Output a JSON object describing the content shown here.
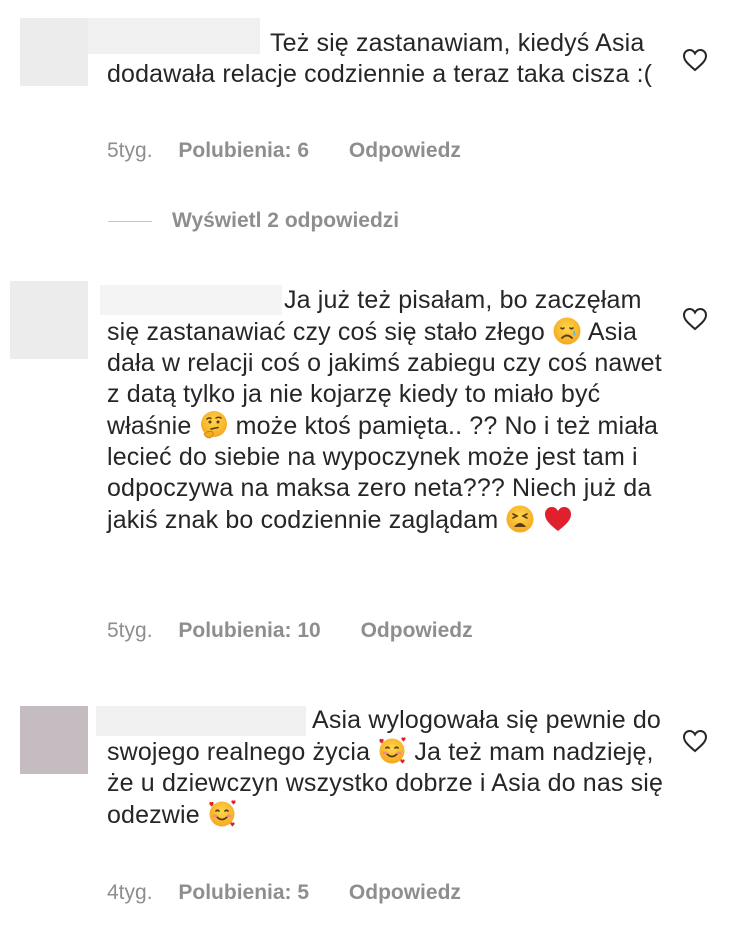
{
  "comments": [
    {
      "text": "Też się zastanawiam, kiedyś Asia dodawała relacje codziennie a teraz taka cisza :(",
      "time": "5tyg.",
      "likes": "Polubienia: 6",
      "reply": "Odpowiedz",
      "view_replies": "Wyświetl 2 odpowiedzi"
    },
    {
      "part1": "Ja już też pisałam, bo zaczęłam się zastanawiać czy coś się stało złego",
      "part2": "Asia dała w relacji coś o jakimś zabiegu czy coś nawet z datą tylko ja nie kojarzę kiedy to miało być właśnie",
      "part3": "może ktoś pamięta.. ?? No i też miała lecieć do siebie na wypoczynek może jest tam i odpoczywa na maksa zero neta??? Niech już da jakiś znak bo codziennie zaglądam",
      "time": "5tyg.",
      "likes": "Polubienia: 10",
      "reply": "Odpowiedz"
    },
    {
      "part1": "Asia wylogowała się pewnie do swojego realnego życia",
      "part2": "Ja też mam nadzieję, że u dziewczyn wszystko dobrze i Asia do nas się odezwie",
      "time": "4tyg.",
      "likes": "Polubienia: 5",
      "reply": "Odpowiedz"
    }
  ],
  "icons": {
    "like": "heart-outline-icon",
    "sad": "sad-but-relieved-face-emoji",
    "thinking": "thinking-face-emoji",
    "weary": "weary-face-emoji",
    "red_heart": "red-heart-emoji",
    "hearts_face": "smiling-face-with-hearts-emoji"
  },
  "colors": {
    "text": "#262626",
    "secondary": "#8e8e8e",
    "avatar_placeholder": "#ececec",
    "avatar_third": "#c5bcc2"
  }
}
